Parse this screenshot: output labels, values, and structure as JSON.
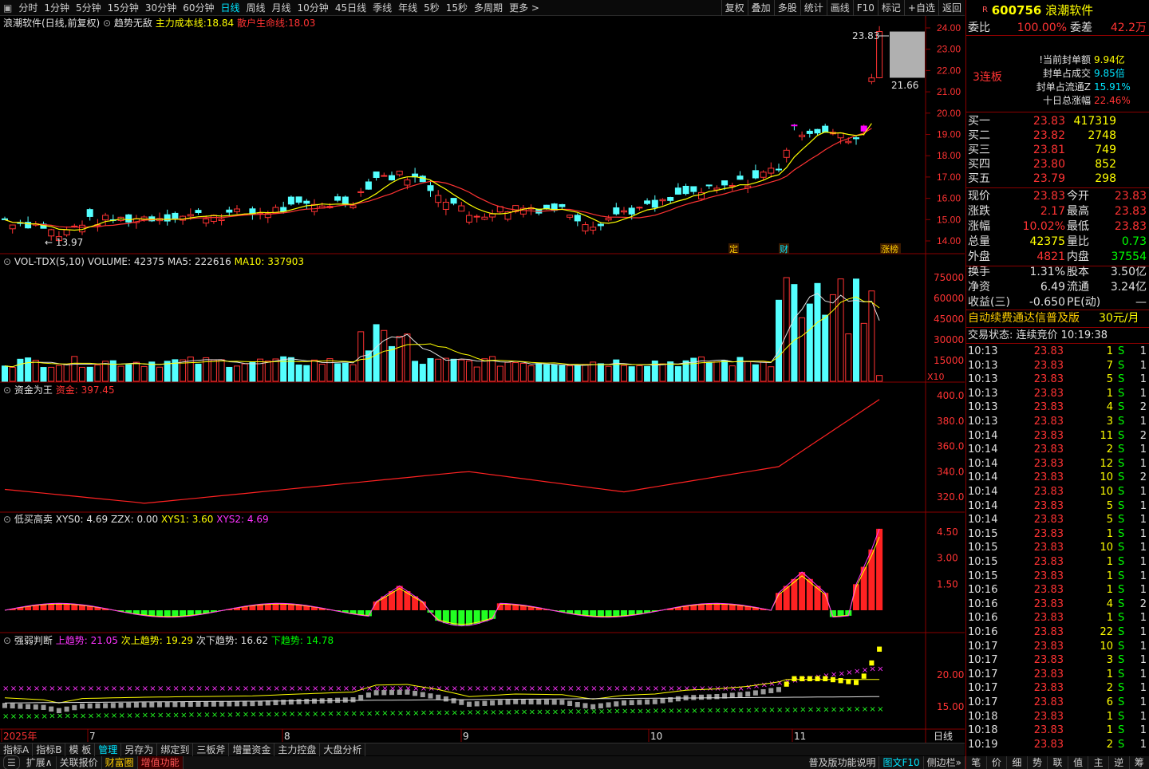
{
  "toolbar": {
    "periods": [
      "分时",
      "1分钟",
      "5分钟",
      "15分钟",
      "30分钟",
      "60分钟",
      "日线",
      "周线",
      "月线",
      "10分钟",
      "45日线",
      "季线",
      "年线",
      "5秒",
      "15秒",
      "多周期",
      "更多 >"
    ],
    "active_period": "日线",
    "tools": [
      "复权",
      "叠加",
      "多股",
      "统计",
      "画线",
      "F10",
      "标记",
      "+自选",
      "返回"
    ]
  },
  "main": {
    "title": "浪潮软件(日线,前复权)",
    "indicator_name": "趋势无敌",
    "line1_label": "主力成本线:",
    "line1_value": "18.84",
    "line2_label": "散户生命线:",
    "line2_value": "18.03",
    "high_label": "23.83",
    "low_label": "13.97",
    "cur_low_label": "21.66",
    "yticks": [
      "24.00",
      "23.00",
      "22.00",
      "21.00",
      "20.00",
      "19.00",
      "18.00",
      "17.00",
      "16.00",
      "15.00",
      "14.00"
    ],
    "markers": [
      "定",
      "财",
      "涨榜"
    ]
  },
  "vol": {
    "title": "VOL-TDX(5,10)",
    "volume_label": "VOLUME: 42375",
    "ma5_label": "MA5: 222616",
    "ma10_label": "MA10: 337903",
    "yticks": [
      "75000",
      "60000",
      "45000",
      "30000",
      "15000"
    ],
    "unit": "X10"
  },
  "money": {
    "title": "资金为王",
    "label": "资金: 397.45",
    "yticks": [
      "400.0",
      "380.0",
      "360.0",
      "340.0",
      "320.0"
    ]
  },
  "dm": {
    "title": "低买高卖",
    "xys0": "XYS0: 4.69",
    "zzx": "ZZX: 0.00",
    "xys1": "XYS1: 3.60",
    "xys2": "XYS2: 4.69",
    "yticks": [
      "4.50",
      "3.00",
      "1.50"
    ]
  },
  "qr": {
    "title": "强弱判断",
    "up": "上趋势: 21.05",
    "up2": "次上趋势: 19.29",
    "down2": "次下趋势: 16.62",
    "down": "下趋势: 14.78",
    "yticks": [
      "20.00",
      "15.00"
    ]
  },
  "xaxis": {
    "labels": [
      "2025年",
      "7",
      "8",
      "9",
      "10",
      "11"
    ],
    "period_btn": "日线"
  },
  "chart_data": {
    "type": "candlestick",
    "title": "浪潮软件(日线,前复权)",
    "ylim": [
      13.5,
      24.4
    ],
    "annotations": {
      "max": 23.83,
      "min": 13.97
    },
    "main_lines": [
      {
        "name": "主力成本线",
        "last": 18.84
      },
      {
        "name": "散户生命线",
        "last": 18.03
      }
    ],
    "volume": {
      "last": 42375,
      "ma5": 222616,
      "ma10": 337903
    },
    "money": {
      "last": 397.45
    },
    "trend": {
      "up": 21.05,
      "up2": 19.29,
      "down2": 16.62,
      "down": 14.78
    }
  },
  "right": {
    "stock_code": "600756",
    "stock_name": "浪潮软件",
    "webi_label": "委比",
    "webi_value": "100.00%",
    "wecha_label": "委差",
    "wecha_value": "42.2万",
    "lianban": "3连板",
    "seal": [
      {
        "label": "!当前封单额",
        "value": "9.94亿"
      },
      {
        "label": "封单占成交",
        "value": "9.85倍"
      },
      {
        "label": "封单占流通Z",
        "value": "15.91%"
      },
      {
        "label": "十日总涨幅",
        "value": "22.46%"
      }
    ],
    "bids": [
      {
        "label": "买一",
        "price": "23.83",
        "vol": "417319"
      },
      {
        "label": "买二",
        "price": "23.82",
        "vol": "2748"
      },
      {
        "label": "买三",
        "price": "23.81",
        "vol": "749"
      },
      {
        "label": "买四",
        "price": "23.80",
        "vol": "852"
      },
      {
        "label": "买五",
        "price": "23.79",
        "vol": "298"
      }
    ],
    "quote": [
      {
        "l1": "现价",
        "v1": "23.83",
        "l2": "今开",
        "v2": "23.83",
        "c1": "#ff3333",
        "c2": "#ff3333"
      },
      {
        "l1": "涨跌",
        "v1": "2.17",
        "l2": "最高",
        "v2": "23.83",
        "c1": "#ff3333",
        "c2": "#ff3333"
      },
      {
        "l1": "涨幅",
        "v1": "10.02%",
        "l2": "最低",
        "v2": "23.83",
        "c1": "#ff3333",
        "c2": "#ff3333"
      },
      {
        "l1": "总量",
        "v1": "42375",
        "l2": "量比",
        "v2": "0.73",
        "c1": "#ffff00",
        "c2": "#00ff00"
      },
      {
        "l1": "外盘",
        "v1": "4821",
        "l2": "内盘",
        "v2": "37554",
        "c1": "#ff3333",
        "c2": "#00ff00"
      },
      {
        "l1": "换手",
        "v1": "1.31%",
        "l2": "股本",
        "v2": "3.50亿",
        "c1": "#e0e0e0",
        "c2": "#e0e0e0"
      },
      {
        "l1": "净资",
        "v1": "6.49",
        "l2": "流通",
        "v2": "3.24亿",
        "c1": "#e0e0e0",
        "c2": "#e0e0e0"
      },
      {
        "l1": "收益(三)",
        "v1": "-0.650",
        "l2": "PE(动)",
        "v2": "—",
        "c1": "#e0e0e0",
        "c2": "#e0e0e0"
      }
    ],
    "ad": "自动续费通达信普及版",
    "ad_price": "30元/月",
    "trade_status": "交易状态: 连续竞价 10:19:38",
    "ticks": [
      [
        "10:13",
        "23.83",
        "1",
        "S",
        "1"
      ],
      [
        "10:13",
        "23.83",
        "7",
        "S",
        "1"
      ],
      [
        "10:13",
        "23.83",
        "5",
        "S",
        "1"
      ],
      [
        "10:13",
        "23.83",
        "1",
        "S",
        "1"
      ],
      [
        "10:13",
        "23.83",
        "4",
        "S",
        "2"
      ],
      [
        "10:13",
        "23.83",
        "3",
        "S",
        "1"
      ],
      [
        "10:14",
        "23.83",
        "11",
        "S",
        "2"
      ],
      [
        "10:14",
        "23.83",
        "2",
        "S",
        "1"
      ],
      [
        "10:14",
        "23.83",
        "12",
        "S",
        "1"
      ],
      [
        "10:14",
        "23.83",
        "10",
        "S",
        "2"
      ],
      [
        "10:14",
        "23.83",
        "10",
        "S",
        "1"
      ],
      [
        "10:14",
        "23.83",
        "5",
        "S",
        "1"
      ],
      [
        "10:14",
        "23.83",
        "5",
        "S",
        "1"
      ],
      [
        "10:15",
        "23.83",
        "1",
        "S",
        "1"
      ],
      [
        "10:15",
        "23.83",
        "10",
        "S",
        "1"
      ],
      [
        "10:15",
        "23.83",
        "1",
        "S",
        "1"
      ],
      [
        "10:15",
        "23.83",
        "1",
        "S",
        "1"
      ],
      [
        "10:16",
        "23.83",
        "1",
        "S",
        "1"
      ],
      [
        "10:16",
        "23.83",
        "4",
        "S",
        "2"
      ],
      [
        "10:16",
        "23.83",
        "1",
        "S",
        "1"
      ],
      [
        "10:16",
        "23.83",
        "22",
        "S",
        "1"
      ],
      [
        "10:17",
        "23.83",
        "10",
        "S",
        "1"
      ],
      [
        "10:17",
        "23.83",
        "3",
        "S",
        "1"
      ],
      [
        "10:17",
        "23.83",
        "1",
        "S",
        "1"
      ],
      [
        "10:17",
        "23.83",
        "2",
        "S",
        "1"
      ],
      [
        "10:17",
        "23.83",
        "6",
        "S",
        "1"
      ],
      [
        "10:18",
        "23.83",
        "1",
        "S",
        "1"
      ],
      [
        "10:18",
        "23.83",
        "1",
        "S",
        "1"
      ],
      [
        "10:19",
        "23.83",
        "2",
        "S",
        "1"
      ]
    ],
    "bottom_tabs": [
      "笔",
      "价",
      "细",
      "势",
      "联",
      "值",
      "主",
      "逆",
      "筹"
    ]
  },
  "bottom": {
    "tabs": [
      "指标A",
      "指标B",
      "模 板",
      "管理",
      "另存为",
      "绑定到",
      "三板斧",
      "增量资金",
      "主力控盘",
      "大盘分析"
    ],
    "tabs2": [
      "扩展∧",
      "关联报价",
      "财富圈",
      "增值功能"
    ],
    "right_texts": [
      "普及版功能说明",
      "图文F10",
      "侧边栏»"
    ]
  }
}
